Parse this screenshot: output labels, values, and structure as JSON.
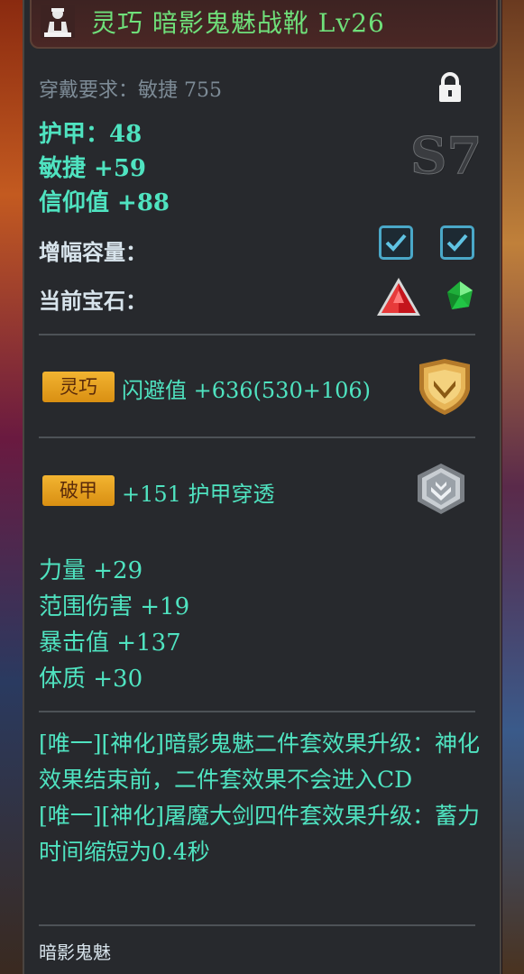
{
  "item": {
    "title": "灵巧 暗影鬼魅战靴 Lv26",
    "requirement": "穿戴要求：敏捷 755",
    "rank": "S7"
  },
  "base_stats": [
    "护甲：48",
    "敏捷 +59",
    "信仰值 +88"
  ],
  "amplify_label": "增幅容量：",
  "gem_label": "当前宝石：",
  "special_attributes": [
    {
      "badge": "灵巧",
      "text": "闪避值 +636(530+106)",
      "emblem": "gold-shield-emblem"
    },
    {
      "badge": "破甲",
      "text": "+151 护甲穿透",
      "emblem": "silver-shield-emblem"
    }
  ],
  "extra_stats": [
    "力量 +29",
    "范围伤害 +19",
    "暴击值 +137",
    "体质 +30"
  ],
  "descriptions": [
    "[唯一][神化]暗影鬼魅二件套效果升级：神化效果结束前，二件套效果不会进入CD",
    "[唯一][神化]屠魔大剑四件套效果升级：蓄力时间缩短为0.4秒"
  ],
  "set_name": "暗影鬼魅",
  "colors": {
    "title": "#6fe07a",
    "stat": "#4fe3c0",
    "badge": "#f2b431",
    "panel": "#27292d"
  }
}
